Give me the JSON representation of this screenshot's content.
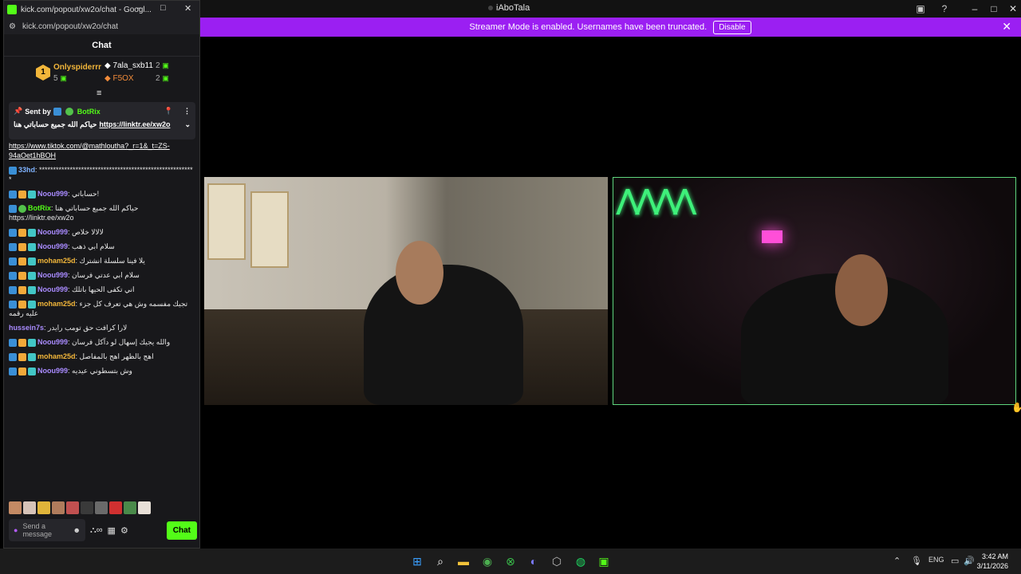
{
  "main_window": {
    "title": "iAboTala",
    "min_icon": "minimize-icon",
    "max_icon": "maximize-icon",
    "close_icon": "close-icon"
  },
  "banner": {
    "text": "Streamer Mode is enabled. Usernames have been truncated.",
    "button_label": "Disable",
    "close_glyph": "✕",
    "color": "#9b1ff2"
  },
  "chat_window": {
    "title": "kick.com/popout/xw2o/chat - Googl...",
    "url": "kick.com/popout/xw2o/chat",
    "header": "Chat",
    "leaders": {
      "first": {
        "rank": "1",
        "name": "Onlyspiderrr",
        "count": "5"
      },
      "second": {
        "name": "7ala_sxb11",
        "count": "2"
      },
      "third": {
        "name": "F5OX",
        "count": "2"
      }
    },
    "pinned": {
      "sent_by": "Sent by",
      "sender": "BotRix",
      "text": "حياكم الله جميع حساباتي هنا",
      "link": "https://linktr.ee/xw2o"
    },
    "messages": [
      {
        "user": "",
        "text": "https://www.tiktok.com/@mathloutha?_r=1&_t=ZS-94aOet1hBOH"
      },
      {
        "user": "33hd",
        "text": "********************************************************"
      },
      {
        "user": "Noou999",
        "text": "حساباتي!"
      },
      {
        "user": "BotRix",
        "text": "حياكم الله جميع حساباتي هنا https://linktr.ee/xw2o"
      },
      {
        "user": "Noou999",
        "text": "لالالا خلاص"
      },
      {
        "user": "Noou999",
        "text": "سلام ابي ذهب"
      },
      {
        "user": "moham25d",
        "text": "يلا فينا سلسلة انشترك"
      },
      {
        "user": "Noou999",
        "text": "سلام ابي عدتي فرسان"
      },
      {
        "user": "Noou999",
        "text": "اني تكفى الحيها باتلك"
      },
      {
        "user": "moham25d",
        "text": "تجيك مفسمه وش هي تعرف كل جزء عليه رقمه"
      },
      {
        "user": "hussein7s",
        "text": "لارا كرافت حق تومب رايدر"
      },
      {
        "user": "Noou999",
        "text": "والله يجيك إسهال لو دآكل فرسان"
      },
      {
        "user": "moham25d",
        "text": "اهج بالظهر اهج بالمفاصل"
      },
      {
        "user": "Noou999",
        "text": "وش بتسطوني عيديه"
      }
    ],
    "input_placeholder": "Send a message",
    "chat_button": "Chat"
  },
  "taskbar": {
    "lang": "ENG",
    "time": "3:42 AM",
    "date": "3/11/2026"
  }
}
